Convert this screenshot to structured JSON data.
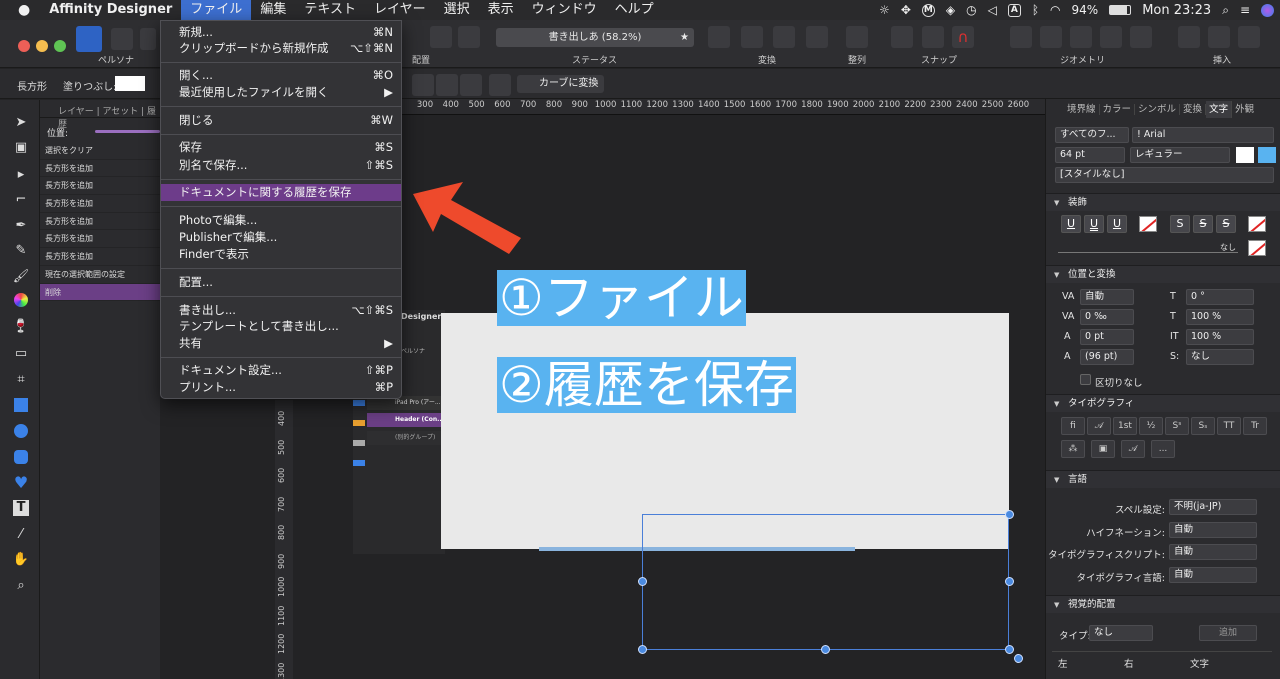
{
  "menubar": {
    "app": "Affinity Designer",
    "items": [
      "ファイル",
      "編集",
      "テキスト",
      "レイヤー",
      "選択",
      "表示",
      "ウィンドウ",
      "ヘルプ"
    ],
    "battery": "94%",
    "clock": "Mon 23:23",
    "input_indicator": "A"
  },
  "toolbar": {
    "persona_label": "ペルソナ",
    "status_value": "書き出しあ (58.2%)",
    "groups": {
      "place": "配置",
      "status": "ステータス",
      "transform": "変換",
      "align": "整列",
      "snap": "スナップ",
      "geometry": "ジオメトリ",
      "insert": "挿入"
    }
  },
  "contextbar": {
    "shape": "長方形",
    "fill_label": "塗りつぶし:",
    "convert_curves": "カーブに変換"
  },
  "history_panel": {
    "tabs": "レイヤー | アセット | 履歴",
    "position_label": "位置:",
    "rows": [
      "選択をクリア",
      "長方形を追加",
      "長方形を追加",
      "長方形を追加",
      "長方形を追加",
      "長方形を追加",
      "長方形を追加",
      "現在の選択範囲の設定",
      "削除"
    ]
  },
  "file_menu": {
    "items": [
      {
        "label": "新規...",
        "shortcut": "⌘N"
      },
      {
        "label": "クリップボードから新規作成",
        "shortcut": "⌥⇧⌘N"
      },
      {
        "label": "開く...",
        "shortcut": "⌘O"
      },
      {
        "label": "最近使用したファイルを開く",
        "shortcut": "▶"
      },
      {
        "label": "閉じる",
        "shortcut": "⌘W"
      },
      {
        "label": "保存",
        "shortcut": "⌘S"
      },
      {
        "label": "別名で保存...",
        "shortcut": "⇧⌘S"
      },
      {
        "label": "ドキュメントに関する履歴を保存",
        "shortcut": ""
      },
      {
        "label": "Photoで編集...",
        "shortcut": ""
      },
      {
        "label": "Publisherで編集...",
        "shortcut": ""
      },
      {
        "label": "Finderで表示",
        "shortcut": ""
      },
      {
        "label": "配置...",
        "shortcut": ""
      },
      {
        "label": "書き出し...",
        "shortcut": "⌥⇧⌘S"
      },
      {
        "label": "テンプレートとして書き出し...",
        "shortcut": ""
      },
      {
        "label": "共有",
        "shortcut": "▶"
      },
      {
        "label": "ドキュメント設定...",
        "shortcut": "⇧⌘P"
      },
      {
        "label": "プリント...",
        "shortcut": "⌘P"
      }
    ]
  },
  "ruler": {
    "h_ticks": [
      "300",
      "400",
      "500",
      "600",
      "700",
      "800",
      "900",
      "1000",
      "1100",
      "1200",
      "1300",
      "1400",
      "1500",
      "1600",
      "1700",
      "1800",
      "1900",
      "2000",
      "2100",
      "2200",
      "2300",
      "2400",
      "2500",
      "2600"
    ],
    "v_ticks": [
      "400",
      "500",
      "600",
      "700",
      "800",
      "900",
      "1000",
      "1100",
      "1200",
      "1300"
    ]
  },
  "canvas": {
    "callout1": "①ファイル",
    "callout2": "②履歴を保存",
    "embedded_title": "Designer",
    "embedded_persona": "ペルソナ",
    "embedded_rows": [
      "iPad Pro (アー...",
      "Header (Con...",
      "(別的グループ)"
    ]
  },
  "right_panel": {
    "tabs": [
      "境界線",
      "カラー",
      "シンボル",
      "変換",
      "文字",
      "外観"
    ],
    "font_collection": "すべてのフ...",
    "font_name": "! Arial",
    "font_size": "64 pt",
    "font_weight": "レギュラー",
    "style": "[スタイルなし]",
    "decoration_header": "装飾",
    "none_label": "なし",
    "position_header": "位置と変換",
    "tracking": "自動",
    "kerning": "0 ‰",
    "baseline": "0 pt",
    "leading": "(96 pt)",
    "slant": "0 °",
    "h_scale": "100 %",
    "v_scale": "100 %",
    "position_sel": "なし",
    "no_break": "区切りなし",
    "typography_header": "タイポグラフィ",
    "language_header": "言語",
    "spell_label": "スペル設定:",
    "spell_value": "不明(ja-JP)",
    "hyphen_label": "ハイフネーション:",
    "hyphen_value": "自動",
    "script_label": "タイポグラフィスクリプト:",
    "script_value": "自動",
    "lang_label": "タイポグラフィ言語:",
    "lang_value": "自動",
    "optical_header": "視覚的配置",
    "type_label": "タイプ:",
    "type_value": "なし",
    "add_button": "追加",
    "col_left": "左",
    "col_right": "右",
    "col_text": "文字"
  },
  "colors": {
    "accent_purple": "#6d3c8a",
    "callout_blue": "#59b3f0",
    "arrow_red": "#ee4a2c"
  }
}
